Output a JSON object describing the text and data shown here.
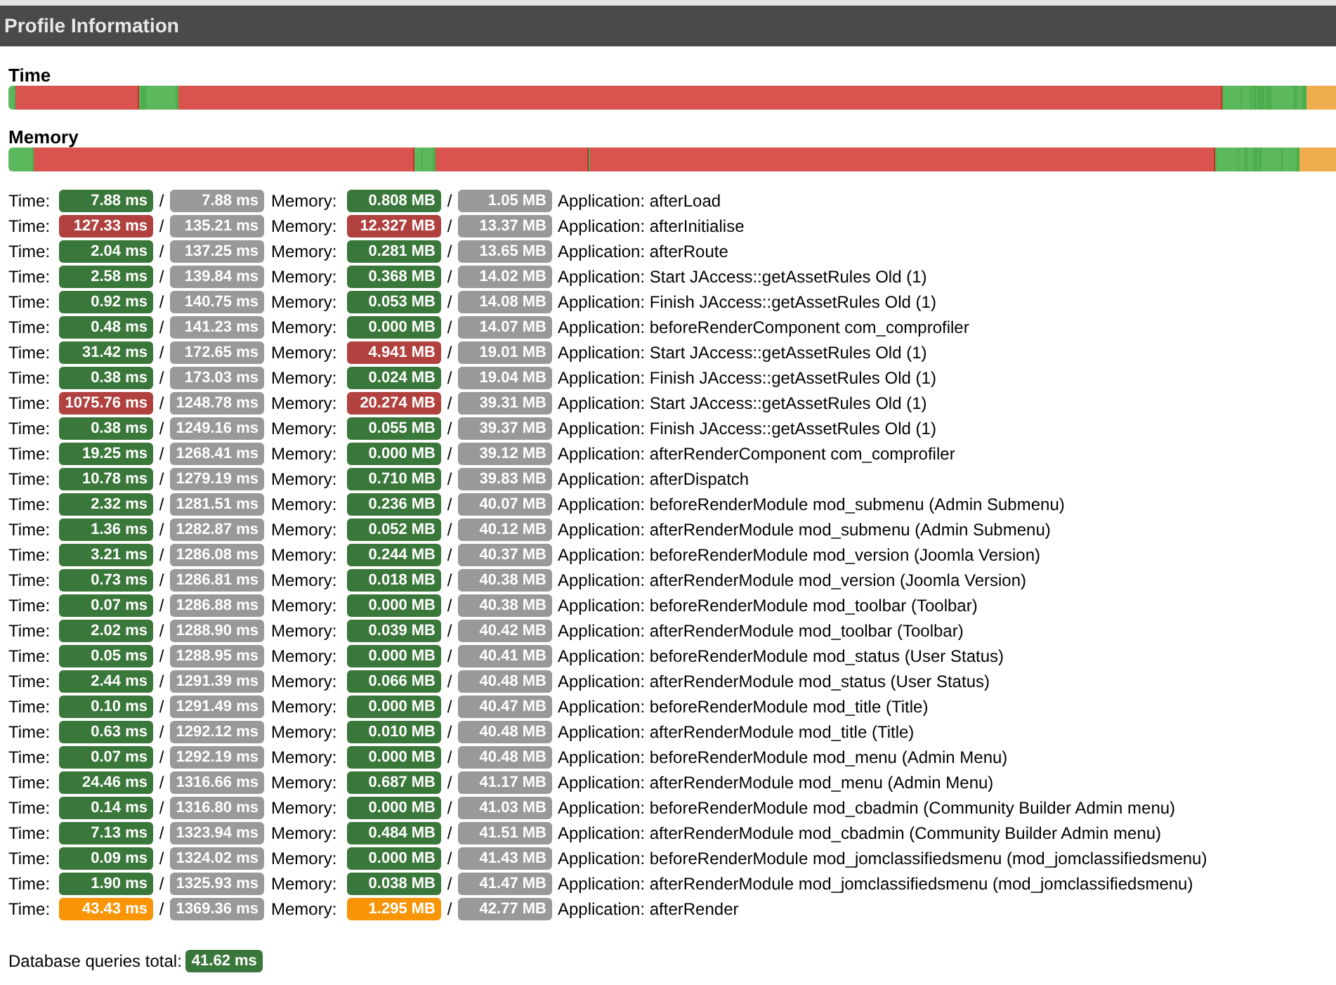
{
  "title": "Profile Information",
  "bars": [
    {
      "label": "Time",
      "kind": "time"
    },
    {
      "label": "Memory",
      "kind": "memory"
    }
  ],
  "rows": [
    {
      "time_label": "Time:",
      "time": {
        "value": "7.88 ms",
        "color": "#3a773a"
      },
      "sep1": "/",
      "time_total": "7.88 ms",
      "memory_label": "Memory:",
      "memory": {
        "value": "0.808 MB",
        "color": "#3a773a"
      },
      "sep2": "/",
      "memory_total": "1.05 MB",
      "event": "Application: afterLoad"
    },
    {
      "time_label": "Time:",
      "time": {
        "value": "127.33 ms",
        "color": "#b0413e"
      },
      "sep1": "/",
      "time_total": "135.21 ms",
      "memory_label": "Memory:",
      "memory": {
        "value": "12.327 MB",
        "color": "#b0413e"
      },
      "sep2": "/",
      "memory_total": "13.37 MB",
      "event": "Application: afterInitialise"
    },
    {
      "time_label": "Time:",
      "time": {
        "value": "2.04 ms",
        "color": "#3a773a"
      },
      "sep1": "/",
      "time_total": "137.25 ms",
      "memory_label": "Memory:",
      "memory": {
        "value": "0.281 MB",
        "color": "#3a773a"
      },
      "sep2": "/",
      "memory_total": "13.65 MB",
      "event": "Application: afterRoute"
    },
    {
      "time_label": "Time:",
      "time": {
        "value": "2.58 ms",
        "color": "#3a773a"
      },
      "sep1": "/",
      "time_total": "139.84 ms",
      "memory_label": "Memory:",
      "memory": {
        "value": "0.368 MB",
        "color": "#3a773a"
      },
      "sep2": "/",
      "memory_total": "14.02 MB",
      "event": "Application: Start JAccess::getAssetRules Old (1)"
    },
    {
      "time_label": "Time:",
      "time": {
        "value": "0.92 ms",
        "color": "#3a773a"
      },
      "sep1": "/",
      "time_total": "140.75 ms",
      "memory_label": "Memory:",
      "memory": {
        "value": "0.053 MB",
        "color": "#3a773a"
      },
      "sep2": "/",
      "memory_total": "14.08 MB",
      "event": "Application: Finish JAccess::getAssetRules Old (1)"
    },
    {
      "time_label": "Time:",
      "time": {
        "value": "0.48 ms",
        "color": "#3a773a"
      },
      "sep1": "/",
      "time_total": "141.23 ms",
      "memory_label": "Memory:",
      "memory": {
        "value": "0.000 MB",
        "color": "#3a773a"
      },
      "sep2": "/",
      "memory_total": "14.07 MB",
      "event": "Application: beforeRenderComponent com_comprofiler"
    },
    {
      "time_label": "Time:",
      "time": {
        "value": "31.42 ms",
        "color": "#3a773a"
      },
      "sep1": "/",
      "time_total": "172.65 ms",
      "memory_label": "Memory:",
      "memory": {
        "value": "4.941 MB",
        "color": "#b0413e"
      },
      "sep2": "/",
      "memory_total": "19.01 MB",
      "event": "Application: Start JAccess::getAssetRules Old (1)"
    },
    {
      "time_label": "Time:",
      "time": {
        "value": "0.38 ms",
        "color": "#3a773a"
      },
      "sep1": "/",
      "time_total": "173.03 ms",
      "memory_label": "Memory:",
      "memory": {
        "value": "0.024 MB",
        "color": "#3a773a"
      },
      "sep2": "/",
      "memory_total": "19.04 MB",
      "event": "Application: Finish JAccess::getAssetRules Old (1)"
    },
    {
      "time_label": "Time:",
      "time": {
        "value": "1075.76 ms",
        "color": "#b0413e"
      },
      "sep1": "/",
      "time_total": "1248.78 ms",
      "memory_label": "Memory:",
      "memory": {
        "value": "20.274 MB",
        "color": "#b0413e"
      },
      "sep2": "/",
      "memory_total": "39.31 MB",
      "event": "Application: Start JAccess::getAssetRules Old (1)"
    },
    {
      "time_label": "Time:",
      "time": {
        "value": "0.38 ms",
        "color": "#3a773a"
      },
      "sep1": "/",
      "time_total": "1249.16 ms",
      "memory_label": "Memory:",
      "memory": {
        "value": "0.055 MB",
        "color": "#3a773a"
      },
      "sep2": "/",
      "memory_total": "39.37 MB",
      "event": "Application: Finish JAccess::getAssetRules Old (1)"
    },
    {
      "time_label": "Time:",
      "time": {
        "value": "19.25 ms",
        "color": "#3a773a"
      },
      "sep1": "/",
      "time_total": "1268.41 ms",
      "memory_label": "Memory:",
      "memory": {
        "value": "0.000 MB",
        "color": "#3a773a"
      },
      "sep2": "/",
      "memory_total": "39.12 MB",
      "event": "Application: afterRenderComponent com_comprofiler"
    },
    {
      "time_label": "Time:",
      "time": {
        "value": "10.78 ms",
        "color": "#3a773a"
      },
      "sep1": "/",
      "time_total": "1279.19 ms",
      "memory_label": "Memory:",
      "memory": {
        "value": "0.710 MB",
        "color": "#3a773a"
      },
      "sep2": "/",
      "memory_total": "39.83 MB",
      "event": "Application: afterDispatch"
    },
    {
      "time_label": "Time:",
      "time": {
        "value": "2.32 ms",
        "color": "#3a773a"
      },
      "sep1": "/",
      "time_total": "1281.51 ms",
      "memory_label": "Memory:",
      "memory": {
        "value": "0.236 MB",
        "color": "#3a773a"
      },
      "sep2": "/",
      "memory_total": "40.07 MB",
      "event": "Application: beforeRenderModule mod_submenu (Admin Submenu)"
    },
    {
      "time_label": "Time:",
      "time": {
        "value": "1.36 ms",
        "color": "#3a773a"
      },
      "sep1": "/",
      "time_total": "1282.87 ms",
      "memory_label": "Memory:",
      "memory": {
        "value": "0.052 MB",
        "color": "#3a773a"
      },
      "sep2": "/",
      "memory_total": "40.12 MB",
      "event": "Application: afterRenderModule mod_submenu (Admin Submenu)"
    },
    {
      "time_label": "Time:",
      "time": {
        "value": "3.21 ms",
        "color": "#3a773a"
      },
      "sep1": "/",
      "time_total": "1286.08 ms",
      "memory_label": "Memory:",
      "memory": {
        "value": "0.244 MB",
        "color": "#3a773a"
      },
      "sep2": "/",
      "memory_total": "40.37 MB",
      "event": "Application: beforeRenderModule mod_version (Joomla Version)"
    },
    {
      "time_label": "Time:",
      "time": {
        "value": "0.73 ms",
        "color": "#3a773a"
      },
      "sep1": "/",
      "time_total": "1286.81 ms",
      "memory_label": "Memory:",
      "memory": {
        "value": "0.018 MB",
        "color": "#3a773a"
      },
      "sep2": "/",
      "memory_total": "40.38 MB",
      "event": "Application: afterRenderModule mod_version (Joomla Version)"
    },
    {
      "time_label": "Time:",
      "time": {
        "value": "0.07 ms",
        "color": "#3a773a"
      },
      "sep1": "/",
      "time_total": "1286.88 ms",
      "memory_label": "Memory:",
      "memory": {
        "value": "0.000 MB",
        "color": "#3a773a"
      },
      "sep2": "/",
      "memory_total": "40.38 MB",
      "event": "Application: beforeRenderModule mod_toolbar (Toolbar)"
    },
    {
      "time_label": "Time:",
      "time": {
        "value": "2.02 ms",
        "color": "#3a773a"
      },
      "sep1": "/",
      "time_total": "1288.90 ms",
      "memory_label": "Memory:",
      "memory": {
        "value": "0.039 MB",
        "color": "#3a773a"
      },
      "sep2": "/",
      "memory_total": "40.42 MB",
      "event": "Application: afterRenderModule mod_toolbar (Toolbar)"
    },
    {
      "time_label": "Time:",
      "time": {
        "value": "0.05 ms",
        "color": "#3a773a"
      },
      "sep1": "/",
      "time_total": "1288.95 ms",
      "memory_label": "Memory:",
      "memory": {
        "value": "0.000 MB",
        "color": "#3a773a"
      },
      "sep2": "/",
      "memory_total": "40.41 MB",
      "event": "Application: beforeRenderModule mod_status (User Status)"
    },
    {
      "time_label": "Time:",
      "time": {
        "value": "2.44 ms",
        "color": "#3a773a"
      },
      "sep1": "/",
      "time_total": "1291.39 ms",
      "memory_label": "Memory:",
      "memory": {
        "value": "0.066 MB",
        "color": "#3a773a"
      },
      "sep2": "/",
      "memory_total": "40.48 MB",
      "event": "Application: afterRenderModule mod_status (User Status)"
    },
    {
      "time_label": "Time:",
      "time": {
        "value": "0.10 ms",
        "color": "#3a773a"
      },
      "sep1": "/",
      "time_total": "1291.49 ms",
      "memory_label": "Memory:",
      "memory": {
        "value": "0.000 MB",
        "color": "#3a773a"
      },
      "sep2": "/",
      "memory_total": "40.47 MB",
      "event": "Application: beforeRenderModule mod_title (Title)"
    },
    {
      "time_label": "Time:",
      "time": {
        "value": "0.63 ms",
        "color": "#3a773a"
      },
      "sep1": "/",
      "time_total": "1292.12 ms",
      "memory_label": "Memory:",
      "memory": {
        "value": "0.010 MB",
        "color": "#3a773a"
      },
      "sep2": "/",
      "memory_total": "40.48 MB",
      "event": "Application: afterRenderModule mod_title (Title)"
    },
    {
      "time_label": "Time:",
      "time": {
        "value": "0.07 ms",
        "color": "#3a773a"
      },
      "sep1": "/",
      "time_total": "1292.19 ms",
      "memory_label": "Memory:",
      "memory": {
        "value": "0.000 MB",
        "color": "#3a773a"
      },
      "sep2": "/",
      "memory_total": "40.48 MB",
      "event": "Application: beforeRenderModule mod_menu (Admin Menu)"
    },
    {
      "time_label": "Time:",
      "time": {
        "value": "24.46 ms",
        "color": "#3a773a"
      },
      "sep1": "/",
      "time_total": "1316.66 ms",
      "memory_label": "Memory:",
      "memory": {
        "value": "0.687 MB",
        "color": "#3a773a"
      },
      "sep2": "/",
      "memory_total": "41.17 MB",
      "event": "Application: afterRenderModule mod_menu (Admin Menu)"
    },
    {
      "time_label": "Time:",
      "time": {
        "value": "0.14 ms",
        "color": "#3a773a"
      },
      "sep1": "/",
      "time_total": "1316.80 ms",
      "memory_label": "Memory:",
      "memory": {
        "value": "0.000 MB",
        "color": "#3a773a"
      },
      "sep2": "/",
      "memory_total": "41.03 MB",
      "event": "Application: beforeRenderModule mod_cbadmin (Community Builder Admin menu)"
    },
    {
      "time_label": "Time:",
      "time": {
        "value": "7.13 ms",
        "color": "#3a773a"
      },
      "sep1": "/",
      "time_total": "1323.94 ms",
      "memory_label": "Memory:",
      "memory": {
        "value": "0.484 MB",
        "color": "#3a773a"
      },
      "sep2": "/",
      "memory_total": "41.51 MB",
      "event": "Application: afterRenderModule mod_cbadmin (Community Builder Admin menu)"
    },
    {
      "time_label": "Time:",
      "time": {
        "value": "0.09 ms",
        "color": "#3a773a"
      },
      "sep1": "/",
      "time_total": "1324.02 ms",
      "memory_label": "Memory:",
      "memory": {
        "value": "0.000 MB",
        "color": "#3a773a"
      },
      "sep2": "/",
      "memory_total": "41.43 MB",
      "event": "Application: beforeRenderModule mod_jomclassifiedsmenu (mod_jomclassifiedsmenu)"
    },
    {
      "time_label": "Time:",
      "time": {
        "value": "1.90 ms",
        "color": "#3a773a"
      },
      "sep1": "/",
      "time_total": "1325.93 ms",
      "memory_label": "Memory:",
      "memory": {
        "value": "0.038 MB",
        "color": "#3a773a"
      },
      "sep2": "/",
      "memory_total": "41.47 MB",
      "event": "Application: afterRenderModule mod_jomclassifiedsmenu (mod_jomclassifiedsmenu)"
    },
    {
      "time_label": "Time:",
      "time": {
        "value": "43.43 ms",
        "color": "#f89406"
      },
      "sep1": "/",
      "time_total": "1369.36 ms",
      "memory_label": "Memory:",
      "memory": {
        "value": "1.295 MB",
        "color": "#f89406"
      },
      "sep2": "/",
      "memory_total": "42.77 MB",
      "event": "Application: afterRender"
    }
  ],
  "database": {
    "label": "Database queries total:",
    "value": "41.62 ms"
  }
}
